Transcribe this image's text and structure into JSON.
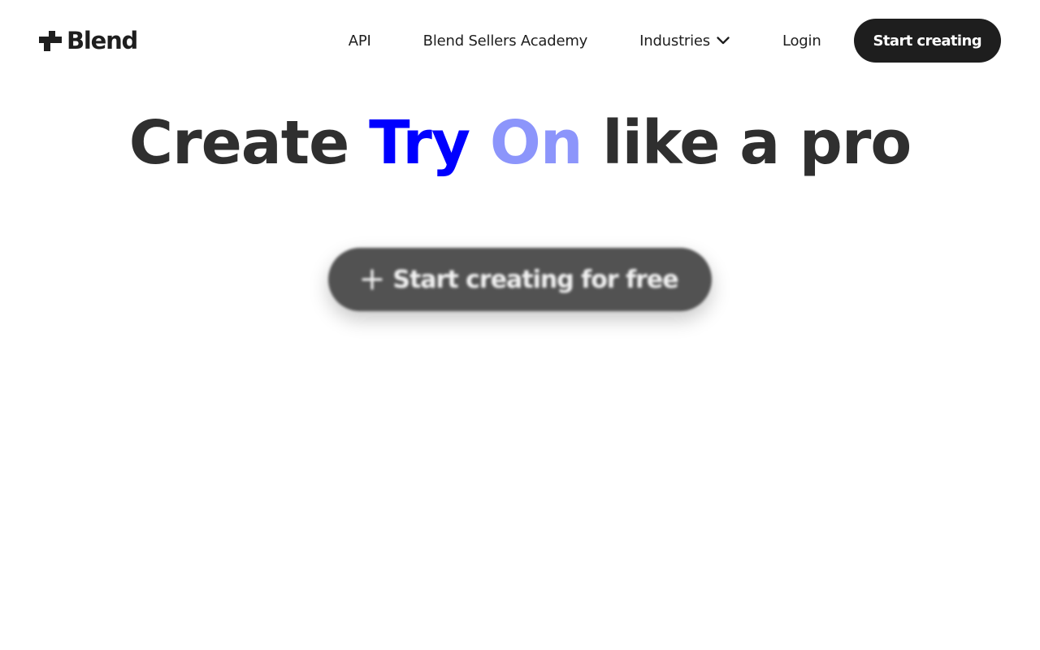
{
  "header": {
    "logo_text": "Blend",
    "nav": {
      "api": "API",
      "academy": "Blend Sellers Academy",
      "industries": "Industries",
      "login": "Login"
    },
    "cta": "Start creating"
  },
  "hero": {
    "title_prefix": "Create",
    "title_try": "Try",
    "title_on": "On",
    "title_suffix": "like a pro",
    "cta": "Start creating for free"
  },
  "icons": {
    "logo": "blend-logo-mark",
    "industries_dropdown": "chevron-down-icon",
    "cta": "plus-icon"
  },
  "colors": {
    "text_dark": "#1e1e1e",
    "title_gray": "#2f2f2f",
    "accent_blue": "#0000ff",
    "accent_light_blue": "#8c95fb",
    "cta_bg": "#1e1e1e",
    "hero_cta_bg": "#525252"
  }
}
